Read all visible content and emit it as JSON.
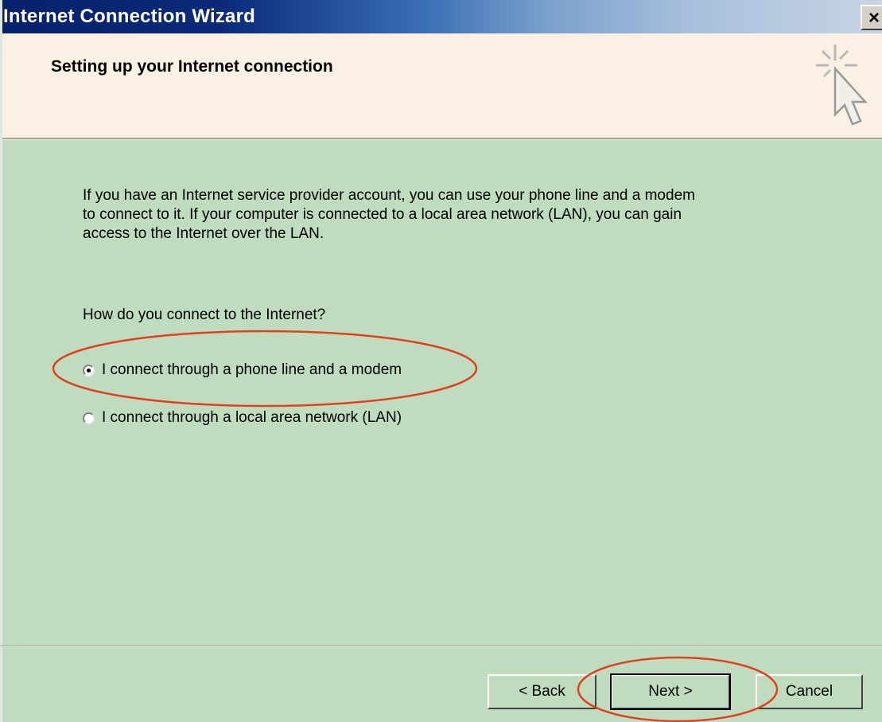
{
  "window": {
    "title": "Internet Connection Wizard",
    "close_glyph": "×"
  },
  "header": {
    "title": "Setting up your Internet connection",
    "icon": "wizard-cursor-sparkle-icon"
  },
  "main": {
    "intro_line1": "If you have an Internet service provider account, you can use your phone line and a modem",
    "intro_line2": "to connect to it. If your computer is connected to a local area network (LAN), you can gain",
    "intro_line3": "access to the Internet over the LAN.",
    "question": "How do you connect to the Internet?",
    "options": [
      {
        "label": "I connect through a phone line and a modem",
        "selected": true
      },
      {
        "label": "I connect through a local area network (LAN)",
        "selected": false
      }
    ]
  },
  "buttons": {
    "back": "< Back",
    "next": "Next >",
    "cancel": "Cancel"
  },
  "annotations": {
    "color": "#e0401c",
    "highlighted": [
      "modem-option",
      "next-button"
    ]
  }
}
